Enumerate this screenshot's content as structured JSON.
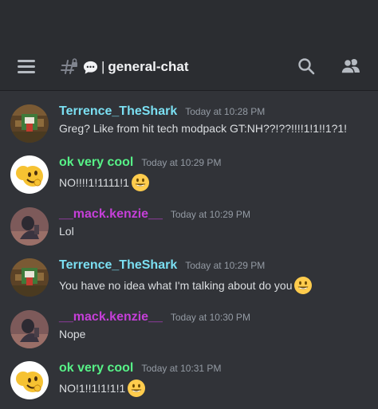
{
  "header": {
    "channel_name": "general-chat",
    "channel_prefix_emoji": "speech-bubble-icon",
    "separator": "|"
  },
  "colors": {
    "background": "#313338",
    "topbar": "#2b2d31",
    "user_cyan": "#7bdff2",
    "user_green": "#57f287",
    "user_purple": "#c53fd8",
    "timestamp": "#949ba4",
    "text": "#dbdee1"
  },
  "messages": [
    {
      "author": "Terrence_TheShark",
      "author_color": "#7bdff2",
      "timestamp": "Today at 10:28 PM",
      "text": "Greg? Like from hit tech modpack GT:NH??!??!!!!1!1!!1?1!",
      "emoji": "",
      "avatar": "minecraft-avatar"
    },
    {
      "author": "ok very cool",
      "author_color": "#57f287",
      "timestamp": "Today at 10:29 PM",
      "text": "NO!!!!1!1111!1",
      "emoji": "grinning-face-icon",
      "avatar": "emoji-avatar"
    },
    {
      "author": "__mack.kenzie__",
      "author_color": "#c53fd8",
      "timestamp": "Today at 10:29 PM",
      "text": "Lol",
      "emoji": "",
      "avatar": "photo-avatar"
    },
    {
      "author": "Terrence_TheShark",
      "author_color": "#7bdff2",
      "timestamp": "Today at 10:29 PM",
      "text": "You have no idea what I'm talking about do you",
      "emoji": "grinning-face-icon",
      "avatar": "minecraft-avatar"
    },
    {
      "author": "__mack.kenzie__",
      "author_color": "#c53fd8",
      "timestamp": "Today at 10:30 PM",
      "text": "Nope",
      "emoji": "",
      "avatar": "photo-avatar"
    },
    {
      "author": "ok very cool",
      "author_color": "#57f287",
      "timestamp": "Today at 10:31 PM",
      "text": "NO!1!!1!1!1!1",
      "emoji": "grinning-face-icon",
      "avatar": "emoji-avatar"
    }
  ]
}
